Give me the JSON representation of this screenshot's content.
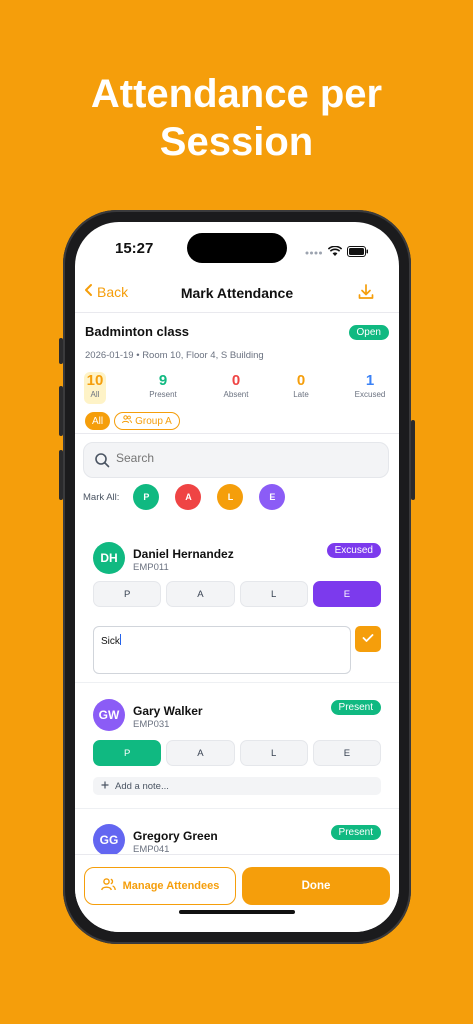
{
  "hero": {
    "line1": "Attendance per",
    "line2": "Session"
  },
  "status_bar": {
    "time": "15:27"
  },
  "nav": {
    "back": "Back",
    "title": "Mark Attendance"
  },
  "session": {
    "title": "Badminton class",
    "status": "Open",
    "meta": "2026-01-19 • Room 10, Floor 4, S Building",
    "stats": [
      {
        "value": "10",
        "label": "All",
        "color": "#F59E0B"
      },
      {
        "value": "9",
        "label": "Present",
        "color": "#10B981"
      },
      {
        "value": "0",
        "label": "Absent",
        "color": "#EF4444"
      },
      {
        "value": "0",
        "label": "Late",
        "color": "#F59E0B"
      },
      {
        "value": "1",
        "label": "Excused",
        "color": "#3B82F6"
      }
    ],
    "filters": {
      "all": "All",
      "group": "Group A"
    }
  },
  "search": {
    "placeholder": "Search"
  },
  "mark_all": {
    "label": "Mark All:",
    "buttons": [
      {
        "label": "P",
        "color": "#10B981"
      },
      {
        "label": "A",
        "color": "#EF4444"
      },
      {
        "label": "L",
        "color": "#F59E0B"
      },
      {
        "label": "E",
        "color": "#8B5CF6"
      }
    ]
  },
  "status_options": [
    "P",
    "A",
    "L",
    "E"
  ],
  "attendees": [
    {
      "initials": "DH",
      "name": "Daniel Hernandez",
      "id": "EMP011",
      "status": "Excused",
      "avatar_color": "#10B981",
      "note": "Sick"
    },
    {
      "initials": "GW",
      "name": "Gary Walker",
      "id": "EMP031",
      "status": "Present",
      "avatar_color": "#8B5CF6",
      "add_note": "Add a note..."
    },
    {
      "initials": "GG",
      "name": "Gregory Green",
      "id": "EMP041",
      "status": "Present",
      "avatar_color": "#6366F1"
    }
  ],
  "bottom": {
    "manage": "Manage Attendees",
    "done": "Done"
  },
  "colors": {
    "accent": "#F59E0B",
    "present": "#10B981",
    "excused": "#7C3AED"
  }
}
